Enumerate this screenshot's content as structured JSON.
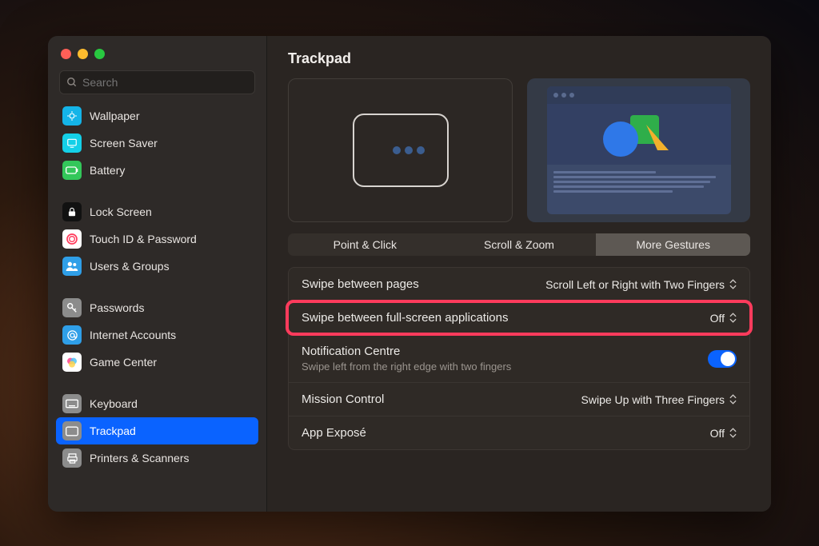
{
  "search": {
    "placeholder": "Search"
  },
  "sidebar": {
    "groups": [
      [
        {
          "label": "Wallpaper",
          "icon": "wallpaper",
          "bg": "#14b4e8"
        },
        {
          "label": "Screen Saver",
          "icon": "screensaver",
          "bg": "#14d0e8"
        },
        {
          "label": "Battery",
          "icon": "battery",
          "bg": "#33c75a"
        }
      ],
      [
        {
          "label": "Lock Screen",
          "icon": "lock",
          "bg": "#111"
        },
        {
          "label": "Touch ID & Password",
          "icon": "touchid",
          "bg": "#fff"
        },
        {
          "label": "Users & Groups",
          "icon": "users",
          "bg": "#2f9fe8"
        }
      ],
      [
        {
          "label": "Passwords",
          "icon": "key",
          "bg": "#8c8c8c"
        },
        {
          "label": "Internet Accounts",
          "icon": "at",
          "bg": "#2f9fe8"
        },
        {
          "label": "Game Center",
          "icon": "gamecenter",
          "bg": "#fff"
        }
      ],
      [
        {
          "label": "Keyboard",
          "icon": "keyboard",
          "bg": "#8c8c8c"
        },
        {
          "label": "Trackpad",
          "icon": "trackpad",
          "bg": "#8c8c8c",
          "active": true
        },
        {
          "label": "Printers & Scanners",
          "icon": "printer",
          "bg": "#8c8c8c"
        }
      ]
    ]
  },
  "page": {
    "title": "Trackpad"
  },
  "tabs": [
    {
      "label": "Point & Click"
    },
    {
      "label": "Scroll & Zoom"
    },
    {
      "label": "More Gestures",
      "active": true
    }
  ],
  "settings": {
    "swipe_pages": {
      "label": "Swipe between pages",
      "value": "Scroll Left or Right with Two Fingers"
    },
    "swipe_fullscreen": {
      "label": "Swipe between full-screen applications",
      "value": "Off"
    },
    "notification_centre": {
      "label": "Notification Centre",
      "sub": "Swipe left from the right edge with two fingers",
      "on": true
    },
    "mission_control": {
      "label": "Mission Control",
      "value": "Swipe Up with Three Fingers"
    },
    "app_expose": {
      "label": "App Exposé",
      "value": "Off"
    }
  }
}
